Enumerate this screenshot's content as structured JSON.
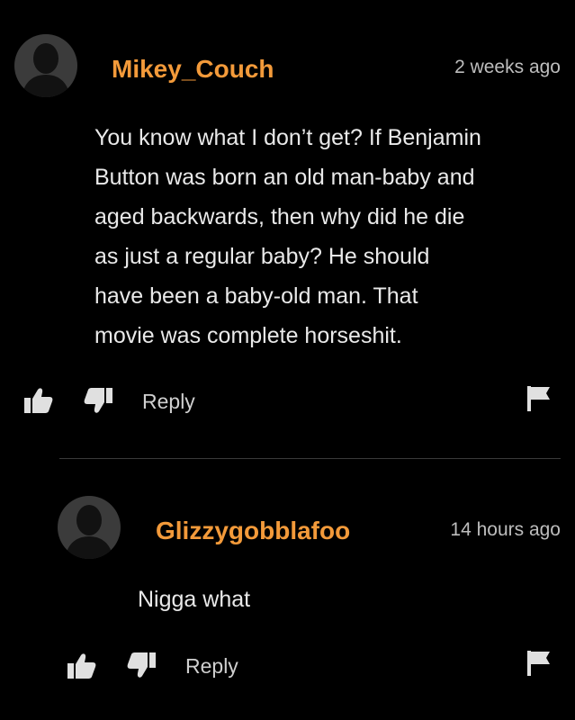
{
  "comments": [
    {
      "username": "Mikey_Couch",
      "timestamp": "2 weeks ago",
      "lines": [
        "You know what I don’t get? If Benjamin",
        "Button was born an old man-baby and",
        "aged backwards, then why did he die",
        "as just a regular baby? He should",
        "have been a baby-old man. That",
        "movie was complete horseshit."
      ],
      "reply_label": "Reply"
    },
    {
      "username": "Glizzygobblafoo",
      "timestamp": "14 hours ago",
      "lines": [
        "Nigga what"
      ],
      "reply_label": "Reply"
    }
  ],
  "icons": {
    "avatar": "default-user-avatar-icon",
    "upvote": "thumbs-up-icon",
    "downvote": "thumbs-down-icon",
    "flag": "flag-icon"
  },
  "colors": {
    "background": "#000000",
    "username": "#f39a3a",
    "text": "#e9e9e9",
    "timestamp": "#bdbdbd",
    "icon": "#e0e0e0",
    "avatar_bg": "#3b3b3b",
    "avatar_fg": "#121212",
    "divider": "#3a3a3a"
  }
}
